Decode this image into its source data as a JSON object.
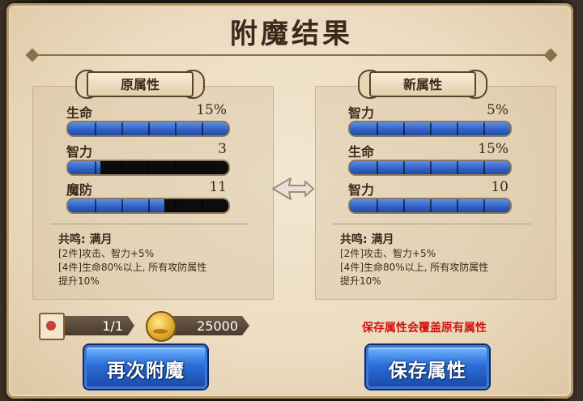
{
  "title": "附魔结果",
  "left_panel": {
    "banner": "原属性",
    "stats": [
      {
        "name": "生命",
        "value": "15%",
        "fill": 1.0
      },
      {
        "name": "智力",
        "value": "3",
        "fill": 0.2
      },
      {
        "name": "魔防",
        "value": "11",
        "fill": 0.6
      }
    ],
    "set_title": "共鸣: 满月",
    "set_lines": [
      "[2件]攻击、智力+5%",
      "[4件]生命80%以上, 所有攻防属性",
      "提升10%"
    ]
  },
  "right_panel": {
    "banner": "新属性",
    "stats": [
      {
        "name": "智力",
        "value": "5%",
        "fill": 1.0
      },
      {
        "name": "生命",
        "value": "15%",
        "fill": 1.0
      },
      {
        "name": "智力",
        "value": "10",
        "fill": 1.0
      }
    ],
    "set_title": "共鸣: 满月",
    "set_lines": [
      "[2件]攻击、智力+5%",
      "[4件]生命80%以上, 所有攻防属性",
      "提升10%"
    ]
  },
  "resources": {
    "scroll_count": "1/1",
    "gold": "25000"
  },
  "warning": "保存属性会覆盖原有属性",
  "buttons": {
    "reenchant": "再次附魔",
    "save": "保存属性"
  },
  "colors": {
    "bar_fill": "#2f5fc4",
    "warning": "#d11414",
    "button": "#2b6ed8"
  }
}
